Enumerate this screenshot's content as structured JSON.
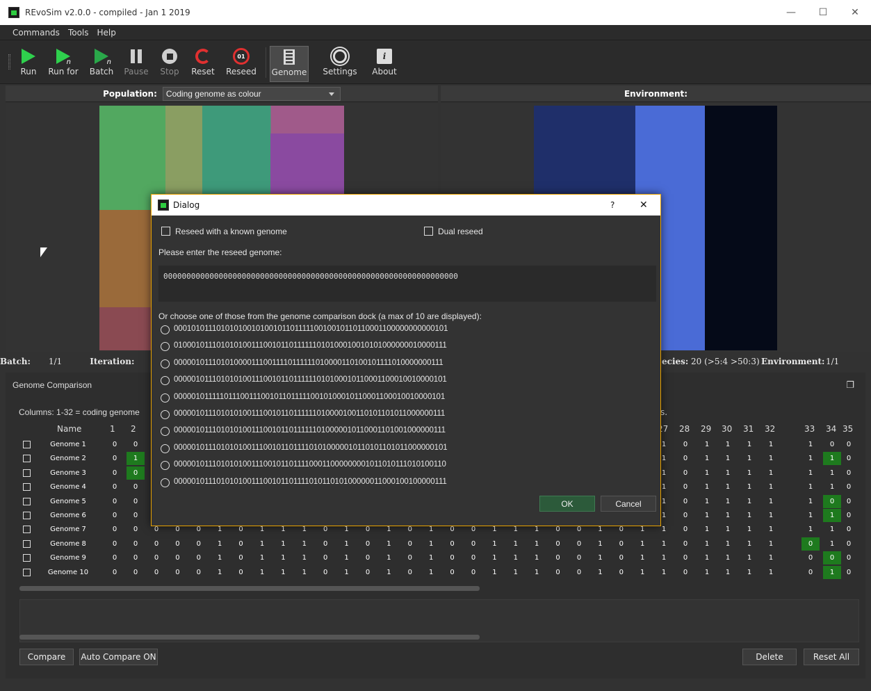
{
  "window": {
    "title": "REvoSim v2.0.0 - compiled - Jan  1 2019",
    "minimize": "—",
    "maximize": "☐",
    "close": "✕"
  },
  "menu": [
    "Commands",
    "Tools",
    "Help"
  ],
  "toolbar": {
    "run": "Run",
    "run_for": "Run for",
    "batch": "Batch",
    "pause": "Pause",
    "stop": "Stop",
    "reset": "Reset",
    "reseed": "Reseed",
    "genome": "Genome",
    "settings": "Settings",
    "about": "About",
    "sub_n": "n",
    "reseed_badge": "01"
  },
  "population": {
    "label": "Population:",
    "mode": "Coding genome as colour"
  },
  "environment": {
    "label": "Environment:"
  },
  "status": {
    "batch_label": "Batch:",
    "batch_value": "1/1",
    "iteration_label": "Iteration:",
    "species_label": "ecies:",
    "species_value": "20 (>5:4 >50:3)",
    "environment_label": "Environment:",
    "environment_value": "1/1"
  },
  "dock": {
    "title": "Genome Comparison",
    "columns_note_left": "Columns: 1-32 = coding genome",
    "columns_note_right": "s.",
    "name_header": "Name",
    "compare": "Compare",
    "auto_compare": "Auto Compare ON",
    "delete": "Delete",
    "reset_all": "Reset All"
  },
  "grid": {
    "headers_left": [
      "1",
      "2"
    ],
    "headers_right": [
      "27",
      "28",
      "29",
      "30",
      "31",
      "32",
      "33",
      "34",
      "35"
    ],
    "rows": [
      {
        "name": "Genome 1",
        "left": [
          "0",
          "0"
        ],
        "right": [
          "1",
          "0",
          "1",
          "1",
          "1",
          "1",
          "1",
          "0",
          "0"
        ],
        "green_left": [],
        "green_right": []
      },
      {
        "name": "Genome 2",
        "left": [
          "0",
          "1"
        ],
        "right": [
          "1",
          "0",
          "1",
          "1",
          "1",
          "1",
          "1",
          "1",
          "0"
        ],
        "green_left": [
          1
        ],
        "green_right": [
          7
        ]
      },
      {
        "name": "Genome 3",
        "left": [
          "0",
          "0"
        ],
        "right": [
          "1",
          "0",
          "1",
          "1",
          "1",
          "1",
          "1",
          "1",
          "0"
        ],
        "green_left": [
          1
        ],
        "green_right": []
      },
      {
        "name": "Genome 4",
        "left": [
          "0",
          "0"
        ],
        "right": [
          "1",
          "0",
          "1",
          "1",
          "1",
          "1",
          "1",
          "1",
          "0"
        ],
        "green_left": [],
        "green_right": []
      },
      {
        "name": "Genome 5",
        "left": [
          "0",
          "0"
        ],
        "right": [
          "1",
          "0",
          "1",
          "1",
          "1",
          "1",
          "1",
          "0",
          "0"
        ],
        "green_left": [],
        "green_right": [
          7
        ]
      },
      {
        "name": "Genome 6",
        "left": [
          "0",
          "0"
        ],
        "right": [
          "1",
          "0",
          "1",
          "1",
          "1",
          "1",
          "1",
          "1",
          "0"
        ],
        "green_left": [],
        "green_right": [
          7
        ]
      },
      {
        "name": "Genome 7",
        "left": [
          "0",
          "0"
        ],
        "right": [
          "1",
          "0",
          "1",
          "1",
          "1",
          "1",
          "1",
          "1",
          "0"
        ],
        "green_left": [],
        "green_right": []
      },
      {
        "name": "Genome 8",
        "left": [
          "0",
          "0"
        ],
        "right": [
          "1",
          "0",
          "1",
          "1",
          "1",
          "1",
          "0",
          "1",
          "0"
        ],
        "green_left": [],
        "green_right": [
          6
        ]
      },
      {
        "name": "Genome 9",
        "left": [
          "0",
          "0"
        ],
        "right": [
          "1",
          "0",
          "1",
          "1",
          "1",
          "1",
          "0",
          "0",
          "0"
        ],
        "green_left": [],
        "green_right": [
          7
        ]
      },
      {
        "name": "Genome 10",
        "left": [
          "0",
          "0"
        ],
        "right": [
          "1",
          "0",
          "1",
          "1",
          "1",
          "1",
          "0",
          "1",
          "0"
        ],
        "green_left": [],
        "green_right": [
          7
        ]
      }
    ],
    "middle_rows": [
      [
        "0",
        "0",
        "0",
        "1",
        "0",
        "1",
        "1",
        "1",
        "0",
        "1",
        "0",
        "1",
        "0",
        "1",
        "0",
        "0",
        "1",
        "1",
        "1",
        "0",
        "0",
        "1",
        "0",
        "1"
      ],
      [
        "0",
        "0",
        "0",
        "1",
        "0",
        "1",
        "1",
        "1",
        "0",
        "1",
        "0",
        "1",
        "0",
        "1",
        "0",
        "0",
        "1",
        "1",
        "1",
        "0",
        "0",
        "1",
        "0",
        "1"
      ],
      [
        "0",
        "0",
        "0",
        "1",
        "0",
        "1",
        "1",
        "1",
        "0",
        "1",
        "0",
        "1",
        "0",
        "1",
        "0",
        "0",
        "1",
        "1",
        "1",
        "0",
        "0",
        "1",
        "0",
        "1"
      ],
      [
        "0",
        "0",
        "0",
        "1",
        "0",
        "1",
        "1",
        "1",
        "0",
        "1",
        "0",
        "1",
        "0",
        "1",
        "0",
        "0",
        "1",
        "1",
        "1",
        "0",
        "0",
        "1",
        "0",
        "1"
      ]
    ]
  },
  "dialog": {
    "title": "Dialog",
    "help": "?",
    "close": "✕",
    "known_genome": "Reseed with a known genome",
    "dual_reseed": "Dual reseed",
    "prompt": "Please enter the reseed genome:",
    "genome_input": "0000000000000000000000000000000000000000000000000000000000000000",
    "choose_text": "Or choose one of those from the genome comparison dock (a max  of 10 are displayed):",
    "options": [
      "0001010111010101001010010110111110010010110110001100000000000101",
      "0100010111010101001110010110111111010100010010101000000010000111",
      "0000010111010100001110011110111111010000110100101111010000000111",
      "0000010111010101001110010110111111010100010110001100010010000101",
      "0000010111110111001110010110111110010100010110001100010010000101",
      "0000010111010101001110010110111111010000100110101101011000000111",
      "0000010111010101001110010110111111010000010110001101001000000111",
      "0000010111010101001110010110111101010000010110101101011000000101",
      "0000010111010101001110010110111100011000000001011010111010100110",
      "0000010111010101001110010110111101011010100000011000100100000111"
    ],
    "ok": "OK",
    "cancel": "Cancel"
  },
  "colors": {
    "accent_green": "#2fd04d",
    "diff_green": "#1e7a1e",
    "dialog_border": "#e8a200",
    "env_dark_blue": "#1f2f6a",
    "env_blue": "#4a6bd6",
    "env_black": "#050a18"
  }
}
